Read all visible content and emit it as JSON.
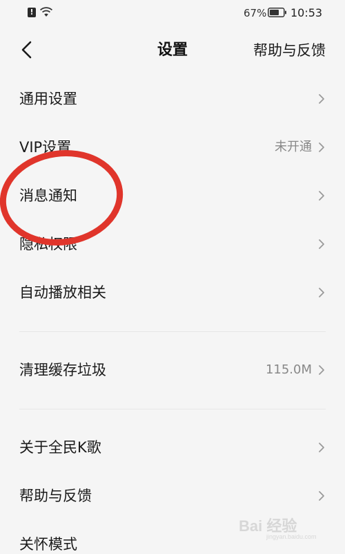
{
  "status_bar": {
    "battery_percent": "67%",
    "time": "10:53",
    "alert_glyph": "!",
    "icons": [
      "alert-icon",
      "wifi-icon",
      "battery-icon"
    ]
  },
  "nav": {
    "title": "设置",
    "help_link": "帮助与反馈",
    "back_icon": "chevron-left-icon"
  },
  "groups": [
    {
      "items": [
        {
          "label": "通用设置",
          "value": ""
        },
        {
          "label": "VIP设置",
          "value": "未开通"
        },
        {
          "label": "消息通知",
          "value": ""
        },
        {
          "label": "隐私权限",
          "value": ""
        },
        {
          "label": "自动播放相关",
          "value": ""
        }
      ]
    },
    {
      "items": [
        {
          "label": "清理缓存垃圾",
          "value": "115.0M"
        }
      ]
    },
    {
      "items": [
        {
          "label": "关于全民K歌",
          "value": ""
        },
        {
          "label": "帮助与反馈",
          "value": ""
        },
        {
          "label": "关怀模式",
          "value": ""
        }
      ]
    }
  ],
  "annotation": {
    "color": "#e0352b",
    "highlighted_item": "消息通知"
  },
  "watermark": {
    "text": "Bai 经验",
    "sub": "jingyan.baidu.com"
  },
  "colors": {
    "background": "#f5f5f5",
    "text": "#1a1a1a",
    "secondary_text": "#888888",
    "annotation": "#e0352b"
  }
}
